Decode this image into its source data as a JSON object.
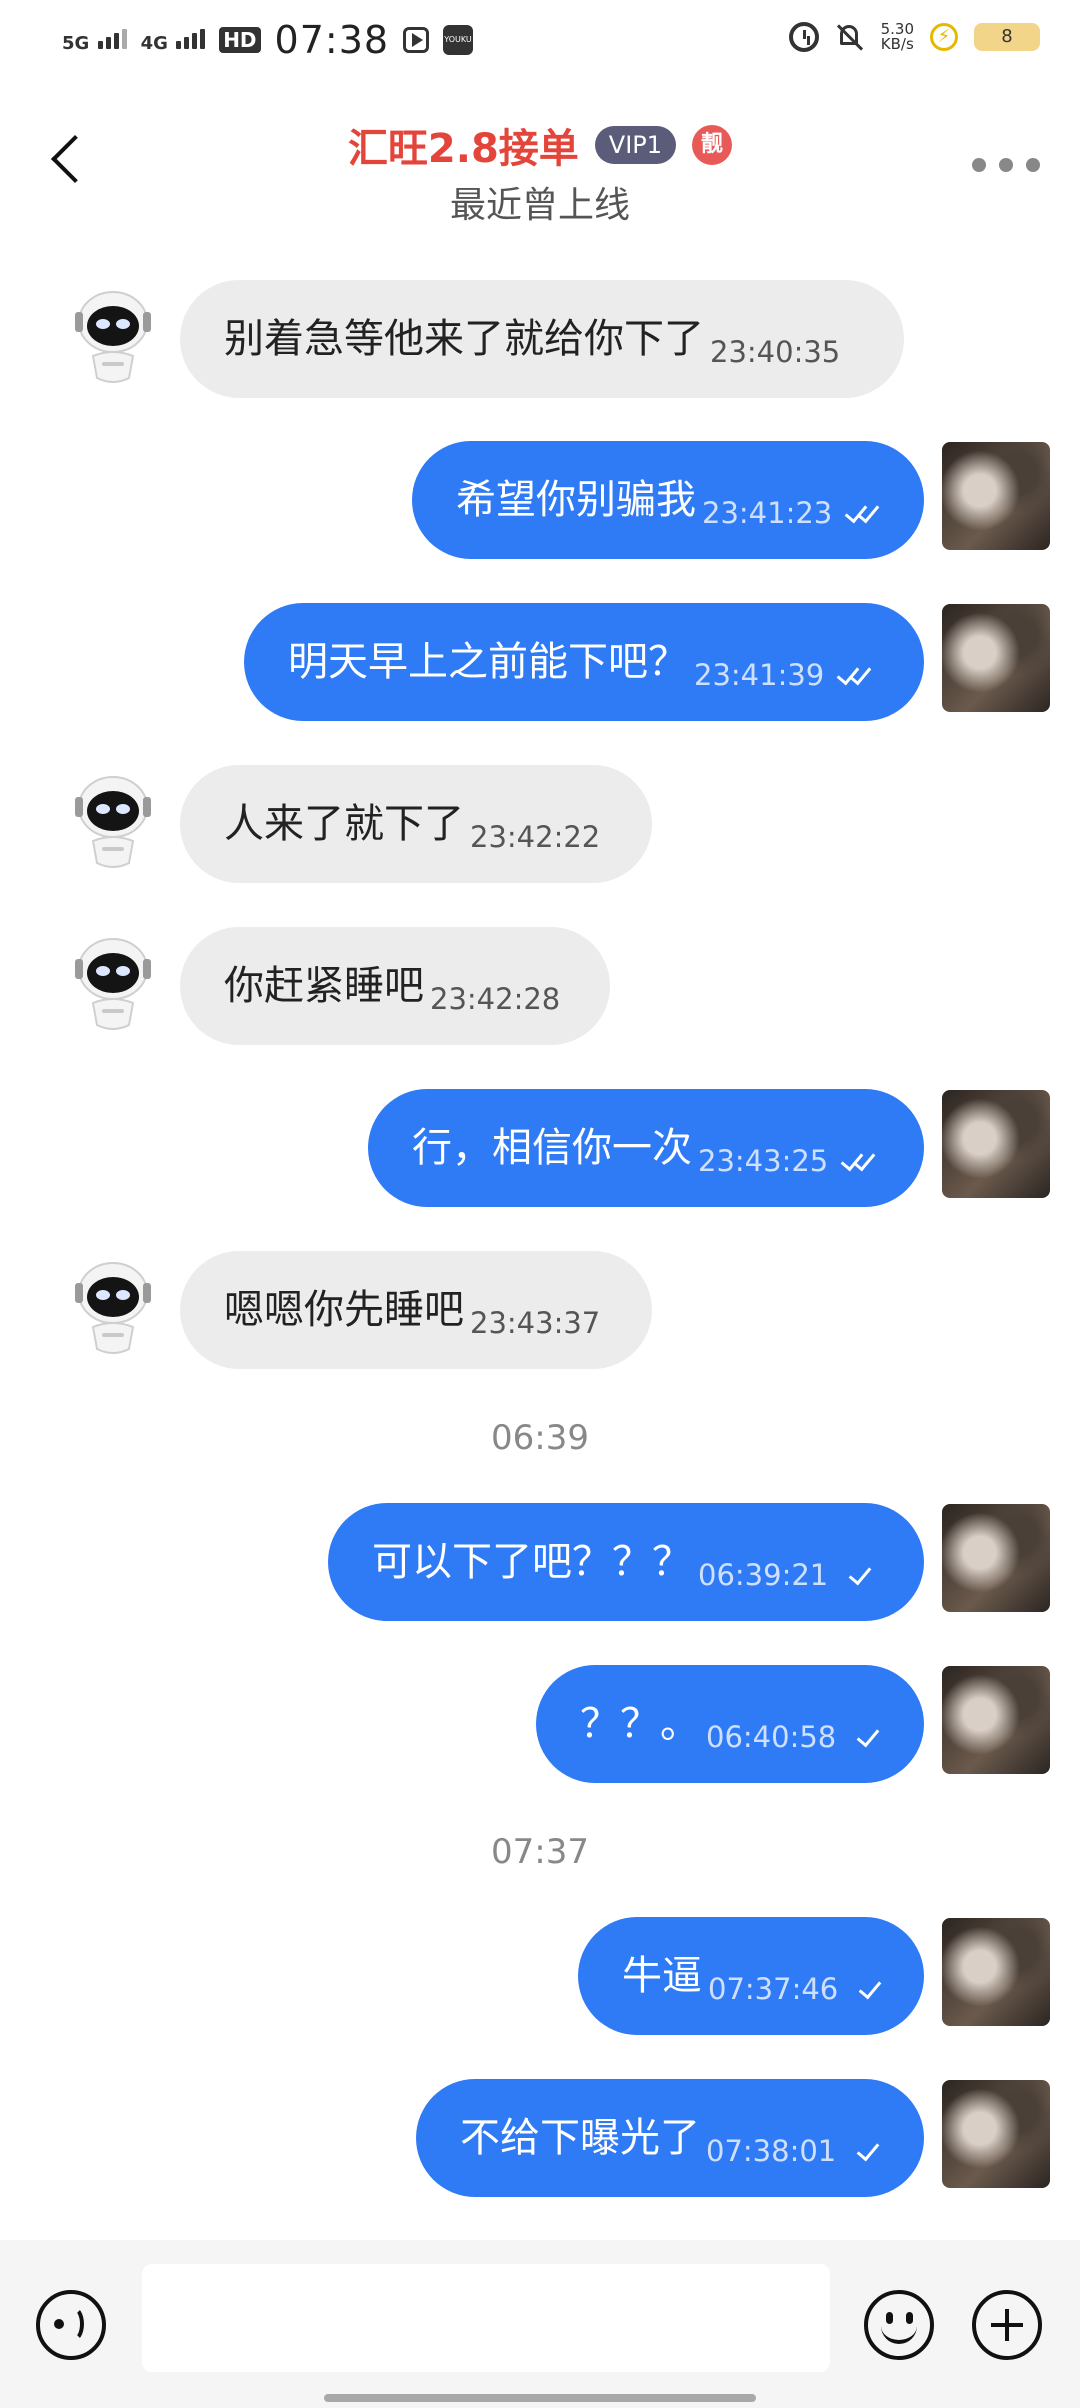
{
  "status_bar": {
    "net1": "5G",
    "net2": "4G",
    "hd": "HD",
    "time": "07:38",
    "speed_value": "5.30",
    "speed_unit": "KB/s",
    "battery": "8",
    "app_icon_text": "YOUKU"
  },
  "header": {
    "title": "汇旺2.8接单",
    "vip": "VIP1",
    "badge": "靓",
    "subtitle": "最近曾上线"
  },
  "messages": [
    {
      "side": "in",
      "text": "别着急等他来了就给你下了",
      "time": "23:40:35"
    },
    {
      "side": "out",
      "text": "希望你别骗我",
      "time": "23:41:23",
      "read": true
    },
    {
      "side": "out",
      "text": "明天早上之前能下吧？",
      "time": "23:41:39",
      "read": true
    },
    {
      "side": "in",
      "text": "人来了就下了",
      "time": "23:42:22"
    },
    {
      "side": "in",
      "text": "你赶紧睡吧",
      "time": "23:42:28"
    },
    {
      "side": "out",
      "text": "行，相信你一次",
      "time": "23:43:25",
      "read": true
    },
    {
      "side": "in",
      "text": "嗯嗯你先睡吧",
      "time": "23:43:37"
    },
    {
      "side": "out",
      "text": "可以下了吧？？？",
      "time": "06:39:21",
      "read": false
    },
    {
      "side": "out",
      "text": "？？。",
      "time": "06:40:58",
      "read": false
    },
    {
      "side": "out",
      "text": "牛逼",
      "time": "07:37:46",
      "read": false
    },
    {
      "side": "out",
      "text": "不给下曝光了",
      "time": "07:38:01",
      "read": false
    }
  ],
  "separators": [
    "06:39",
    "07:37"
  ],
  "input": {
    "value": "",
    "placeholder": ""
  },
  "colors": {
    "title": "#e4453a",
    "outgoing_bubble": "#2f7bf6",
    "incoming_bubble": "#ececec",
    "vip_badge": "#5a5c79"
  }
}
